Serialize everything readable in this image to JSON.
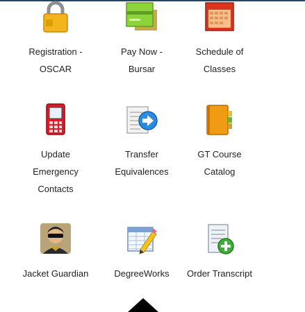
{
  "tiles": [
    {
      "label": "Registration -\nOSCAR",
      "icon": "lock-icon"
    },
    {
      "label": "Pay Now -\nBursar",
      "icon": "credit-card-icon"
    },
    {
      "label": "Schedule of\nClasses",
      "icon": "calendar-icon"
    },
    {
      "label": "Update\nEmergency\nContacts",
      "icon": "mobile-phone-icon"
    },
    {
      "label": "Transfer\nEquivalences",
      "icon": "transfer-document-icon"
    },
    {
      "label": "GT Course\nCatalog",
      "icon": "catalog-book-icon"
    },
    {
      "label": "Jacket Guardian",
      "icon": "guardian-avatar-icon"
    },
    {
      "label": "DegreeWorks",
      "icon": "spreadsheet-pencil-icon"
    },
    {
      "label": "Order Transcript",
      "icon": "transcript-add-icon"
    }
  ],
  "colors": {
    "header_bar": "#24456b",
    "text": "#222222"
  }
}
